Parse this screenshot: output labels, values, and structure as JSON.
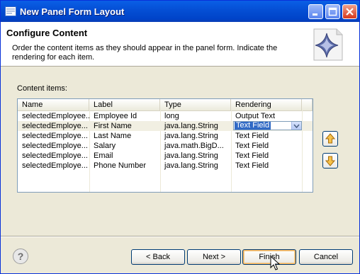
{
  "window": {
    "title": "New Panel Form Layout"
  },
  "header": {
    "title": "Configure Content",
    "description": "Order the content items as they should appear in the panel form.  Indicate the rendering for each item."
  },
  "content": {
    "group_label": "Content items:",
    "columns": [
      "Name",
      "Label",
      "Type",
      "Rendering"
    ],
    "rows": [
      {
        "name": "selectedEmployee...",
        "label": "Employee Id",
        "type": "long",
        "rendering": "Output Text"
      },
      {
        "name": "selectedEmploye...",
        "label": "First Name",
        "type": "java.lang.String",
        "rendering": "Text Field"
      },
      {
        "name": "selectedEmploye...",
        "label": "Last Name",
        "type": "java.lang.String",
        "rendering": "Text Field"
      },
      {
        "name": "selectedEmploye...",
        "label": "Salary",
        "type": "java.math.BigD...",
        "rendering": "Text Field"
      },
      {
        "name": "selectedEmploye...",
        "label": "Email",
        "type": "java.lang.String",
        "rendering": "Text Field"
      },
      {
        "name": "selectedEmploye...",
        "label": "Phone Number",
        "type": "java.lang.String",
        "rendering": "Text Field"
      }
    ],
    "selected_row": 1
  },
  "buttons": {
    "back": "< Back",
    "next": "Next >",
    "finish": "Finish",
    "cancel": "Cancel",
    "help": "?"
  },
  "colors": {
    "title_bar": "#0550d6",
    "selection": "#316ac5",
    "dialog_bg": "#ece9d8"
  }
}
